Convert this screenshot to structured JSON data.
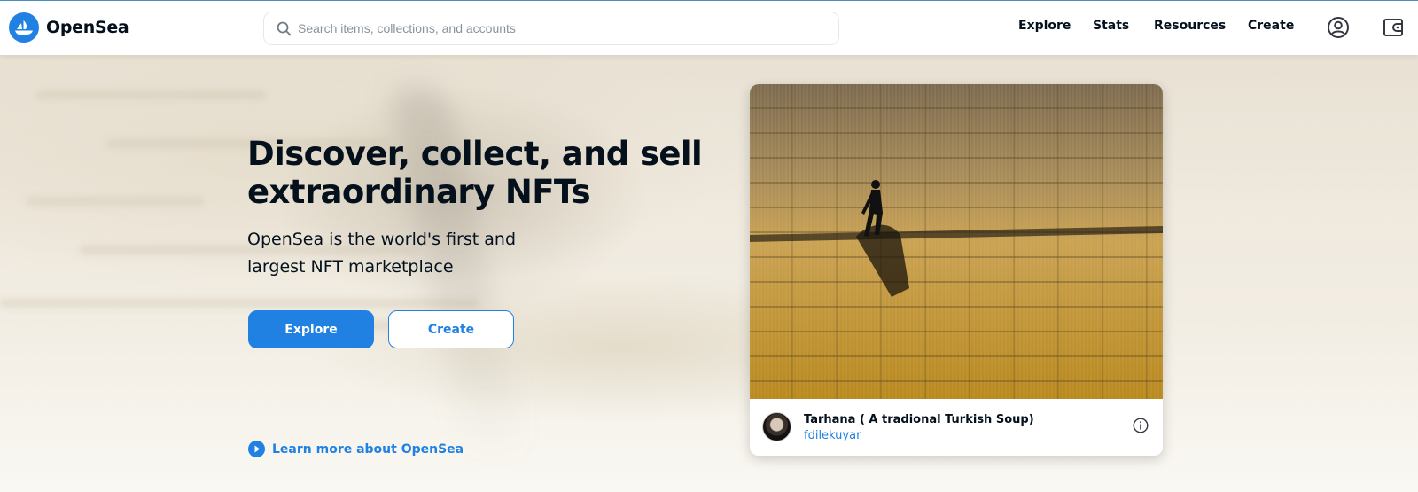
{
  "header": {
    "brand": "OpenSea",
    "search_placeholder": "Search items, collections, and accounts",
    "nav": [
      "Explore",
      "Stats",
      "Resources",
      "Create"
    ]
  },
  "hero": {
    "title": "Discover, collect, and sell extraordinary NFTs",
    "subtitle": "OpenSea is the world's first and largest NFT marketplace",
    "primary_button": "Explore",
    "secondary_button": "Create",
    "learn_more": "Learn more about OpenSea"
  },
  "featured": {
    "title": "Tarhana ( A tradional Turkish Soup)",
    "creator": "fdilekuyar"
  },
  "colors": {
    "accent": "#2081e2",
    "text": "#04111d"
  },
  "icons": {
    "logo": "opensea-logo-icon",
    "search": "search-icon",
    "account": "account-icon",
    "wallet": "wallet-icon",
    "play": "play-circle-icon",
    "info": "info-icon"
  }
}
